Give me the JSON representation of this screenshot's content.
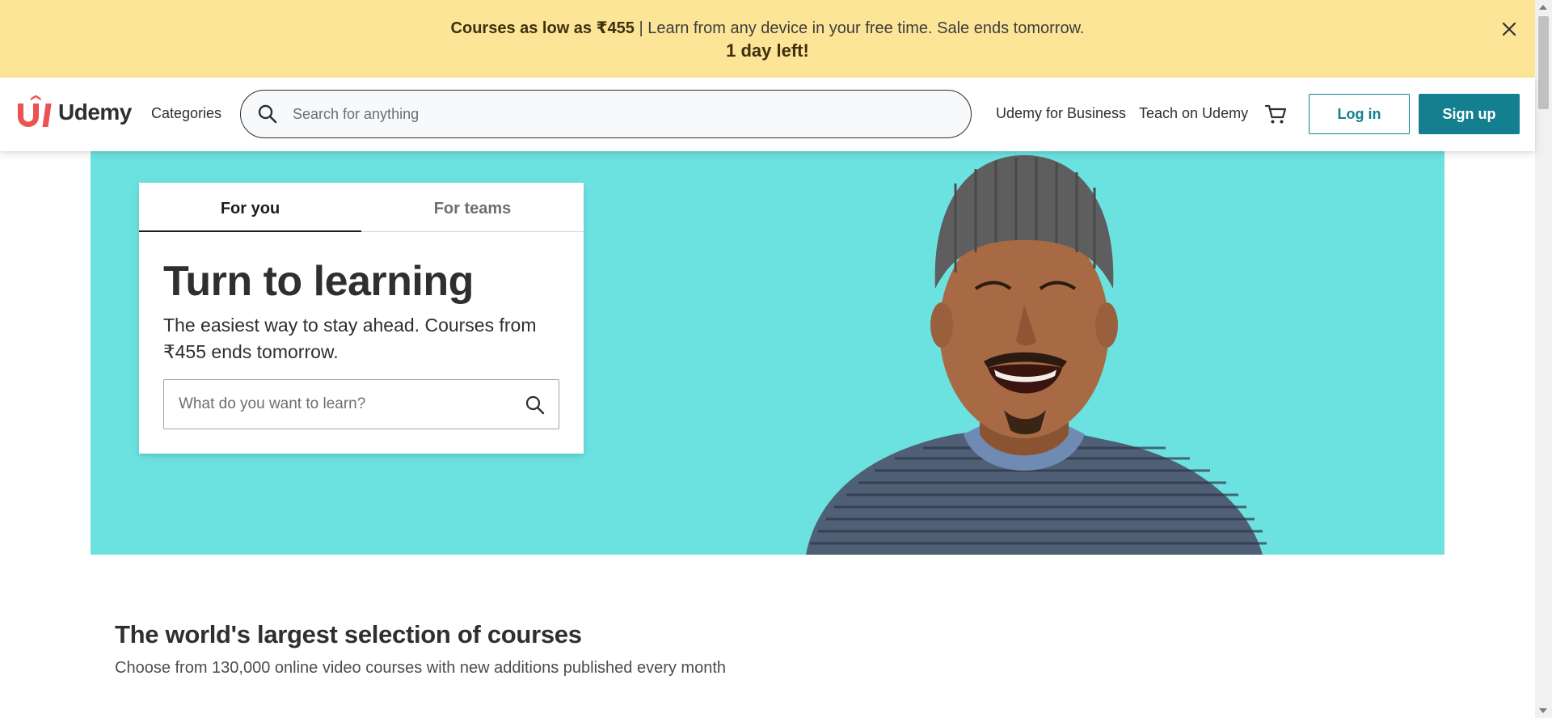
{
  "banner": {
    "bold_text": "Courses as low as ₹455",
    "text": " | Learn from any device in your free time. Sale ends tomorrow.",
    "countdown": "1 day left!"
  },
  "header": {
    "logo_text": "Udemy",
    "categories_label": "Categories",
    "search_placeholder": "Search for anything",
    "business_link": "Udemy for Business",
    "teach_link": "Teach on Udemy",
    "login_label": "Log in",
    "signup_label": "Sign up"
  },
  "hero": {
    "tabs": [
      {
        "label": "For you",
        "active": true
      },
      {
        "label": "For teams",
        "active": false
      }
    ],
    "title": "Turn to learning",
    "subtitle": "The easiest way to stay ahead. Courses from ₹455 ends tomorrow.",
    "search_placeholder": "What do you want to learn?"
  },
  "section": {
    "title": "The world's largest selection of courses",
    "subtitle": "Choose from 130,000 online video courses with new additions published every month"
  },
  "colors": {
    "banner_bg": "#fde597",
    "hero_bg": "#6ce2e0",
    "brand_accent": "#a435f0",
    "logo_red": "#ec5252",
    "teal_button": "#14808f"
  },
  "icons": [
    "close-icon",
    "udemy-logo-icon",
    "search-icon",
    "cart-icon"
  ]
}
